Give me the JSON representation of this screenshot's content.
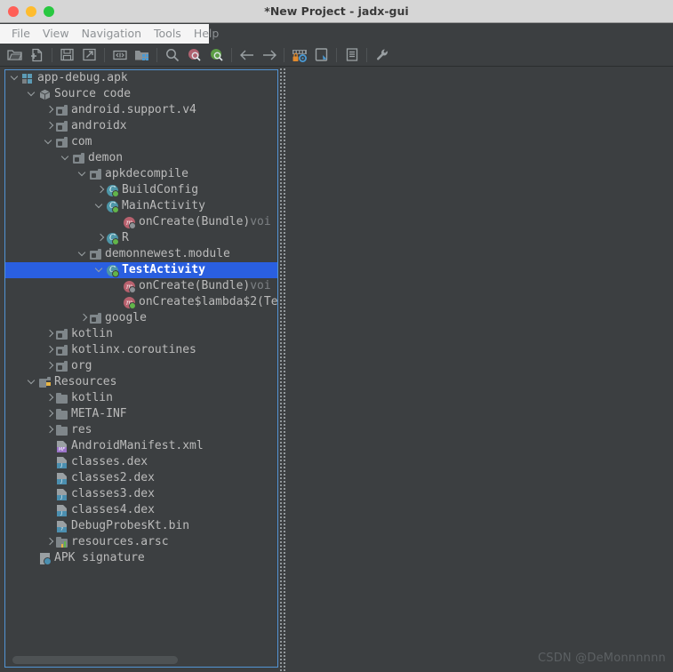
{
  "window": {
    "title": "*New Project - jadx-gui",
    "controls": [
      "close",
      "minimize",
      "maximize"
    ]
  },
  "menubar": {
    "items": [
      {
        "label": "File"
      },
      {
        "label": "View"
      },
      {
        "label": "Navigation"
      },
      {
        "label": "Tools"
      },
      {
        "label": "Help"
      }
    ]
  },
  "toolbar": {
    "buttons": [
      {
        "name": "open-file-icon",
        "kind": "folder-open"
      },
      {
        "name": "add-files-icon",
        "kind": "add-files"
      },
      {
        "name": "save-all-icon",
        "kind": "save"
      },
      {
        "name": "export-gradle-icon",
        "kind": "export"
      },
      {
        "name": "sep1",
        "kind": "separator"
      },
      {
        "name": "sync-icon",
        "kind": "sync"
      },
      {
        "name": "flat-packages-icon",
        "kind": "flat-pkg"
      },
      {
        "name": "sep2",
        "kind": "separator"
      },
      {
        "name": "search-icon",
        "kind": "search-gray"
      },
      {
        "name": "text-search-icon",
        "kind": "search-red"
      },
      {
        "name": "comment-search-icon",
        "kind": "search-green"
      },
      {
        "name": "sep3",
        "kind": "separator"
      },
      {
        "name": "back-arrow-icon",
        "kind": "arrow-left"
      },
      {
        "name": "forward-arrow-icon",
        "kind": "arrow-right"
      },
      {
        "name": "sep4",
        "kind": "separator"
      },
      {
        "name": "deobfuscation-icon",
        "kind": "deobf"
      },
      {
        "name": "quark-engine-icon",
        "kind": "quark"
      },
      {
        "name": "sep5",
        "kind": "separator"
      },
      {
        "name": "log-viewer-icon",
        "kind": "log"
      },
      {
        "name": "sep6",
        "kind": "separator"
      },
      {
        "name": "preferences-icon",
        "kind": "wrench"
      }
    ]
  },
  "tree": {
    "selected_label": "TestActivity",
    "rows": [
      {
        "depth": 0,
        "arrow": "open",
        "icon": "apk",
        "label": "app-debug.apk",
        "dim": false
      },
      {
        "depth": 1,
        "arrow": "open",
        "icon": "box",
        "label": "Source code",
        "dim": false
      },
      {
        "depth": 2,
        "arrow": "closed",
        "icon": "pkg",
        "label": "android.support.v4",
        "dim": false
      },
      {
        "depth": 2,
        "arrow": "closed",
        "icon": "pkg",
        "label": "androidx",
        "dim": false
      },
      {
        "depth": 2,
        "arrow": "open",
        "icon": "pkg",
        "label": "com",
        "dim": false
      },
      {
        "depth": 3,
        "arrow": "open",
        "icon": "pkg",
        "label": "demon",
        "dim": false
      },
      {
        "depth": 4,
        "arrow": "open",
        "icon": "pkg",
        "label": "apkdecompile",
        "dim": false
      },
      {
        "depth": 5,
        "arrow": "closed",
        "icon": "class",
        "label": "BuildConfig",
        "dim": false
      },
      {
        "depth": 5,
        "arrow": "open",
        "icon": "class",
        "label": "MainActivity",
        "dim": false
      },
      {
        "depth": 6,
        "arrow": "none",
        "icon": "method",
        "label": "onCreate(Bundle)",
        "suffix": " voi",
        "dim": false
      },
      {
        "depth": 5,
        "arrow": "closed",
        "icon": "class",
        "label": "R",
        "dim": false
      },
      {
        "depth": 4,
        "arrow": "open",
        "icon": "pkg",
        "label": "demonnewest.module",
        "dim": false
      },
      {
        "depth": 5,
        "arrow": "open",
        "icon": "class",
        "label": "TestActivity",
        "dim": false,
        "selected": true
      },
      {
        "depth": 6,
        "arrow": "none",
        "icon": "method",
        "label": "onCreate(Bundle)",
        "suffix": " voi",
        "dim": false
      },
      {
        "depth": 6,
        "arrow": "none",
        "icon": "method-g",
        "label": "onCreate$lambda$2(Te",
        "dim": false
      },
      {
        "depth": 4,
        "arrow": "closed",
        "icon": "pkg",
        "label": "google",
        "dim": false
      },
      {
        "depth": 2,
        "arrow": "closed",
        "icon": "pkg",
        "label": "kotlin",
        "dim": false
      },
      {
        "depth": 2,
        "arrow": "closed",
        "icon": "pkg",
        "label": "kotlinx.coroutines",
        "dim": false
      },
      {
        "depth": 2,
        "arrow": "closed",
        "icon": "pkg",
        "label": "org",
        "dim": false
      },
      {
        "depth": 1,
        "arrow": "open",
        "icon": "resfolder",
        "label": "Resources",
        "dim": false
      },
      {
        "depth": 2,
        "arrow": "closed",
        "icon": "folder",
        "label": "kotlin",
        "dim": false
      },
      {
        "depth": 2,
        "arrow": "closed",
        "icon": "folder",
        "label": "META-INF",
        "dim": false
      },
      {
        "depth": 2,
        "arrow": "closed",
        "icon": "folder",
        "label": "res",
        "dim": false
      },
      {
        "depth": 2,
        "arrow": "none",
        "icon": "file-mf",
        "label": "AndroidManifest.xml",
        "dim": false
      },
      {
        "depth": 2,
        "arrow": "none",
        "icon": "file-j",
        "label": "classes.dex",
        "dim": false
      },
      {
        "depth": 2,
        "arrow": "none",
        "icon": "file-j",
        "label": "classes2.dex",
        "dim": false
      },
      {
        "depth": 2,
        "arrow": "none",
        "icon": "file-j",
        "label": "classes3.dex",
        "dim": false
      },
      {
        "depth": 2,
        "arrow": "none",
        "icon": "file-j",
        "label": "classes4.dex",
        "dim": false
      },
      {
        "depth": 2,
        "arrow": "none",
        "icon": "file-q",
        "label": "DebugProbesKt.bin",
        "dim": false
      },
      {
        "depth": 2,
        "arrow": "closed",
        "icon": "arsc",
        "label": "resources.arsc",
        "dim": false
      },
      {
        "depth": 1,
        "arrow": "none",
        "icon": "sig",
        "label": "APK signature",
        "dim": false
      }
    ]
  },
  "watermark": {
    "text": "CSDN @DeMonnnnnn"
  },
  "colors": {
    "window_bg": "#3c3f41",
    "titlebar_bg": "#d6d6d6",
    "selection_blue": "#2a5fe0",
    "panel_border": "#5394d4",
    "text": "#bbbbbb",
    "menu_text": "#8e9295"
  }
}
